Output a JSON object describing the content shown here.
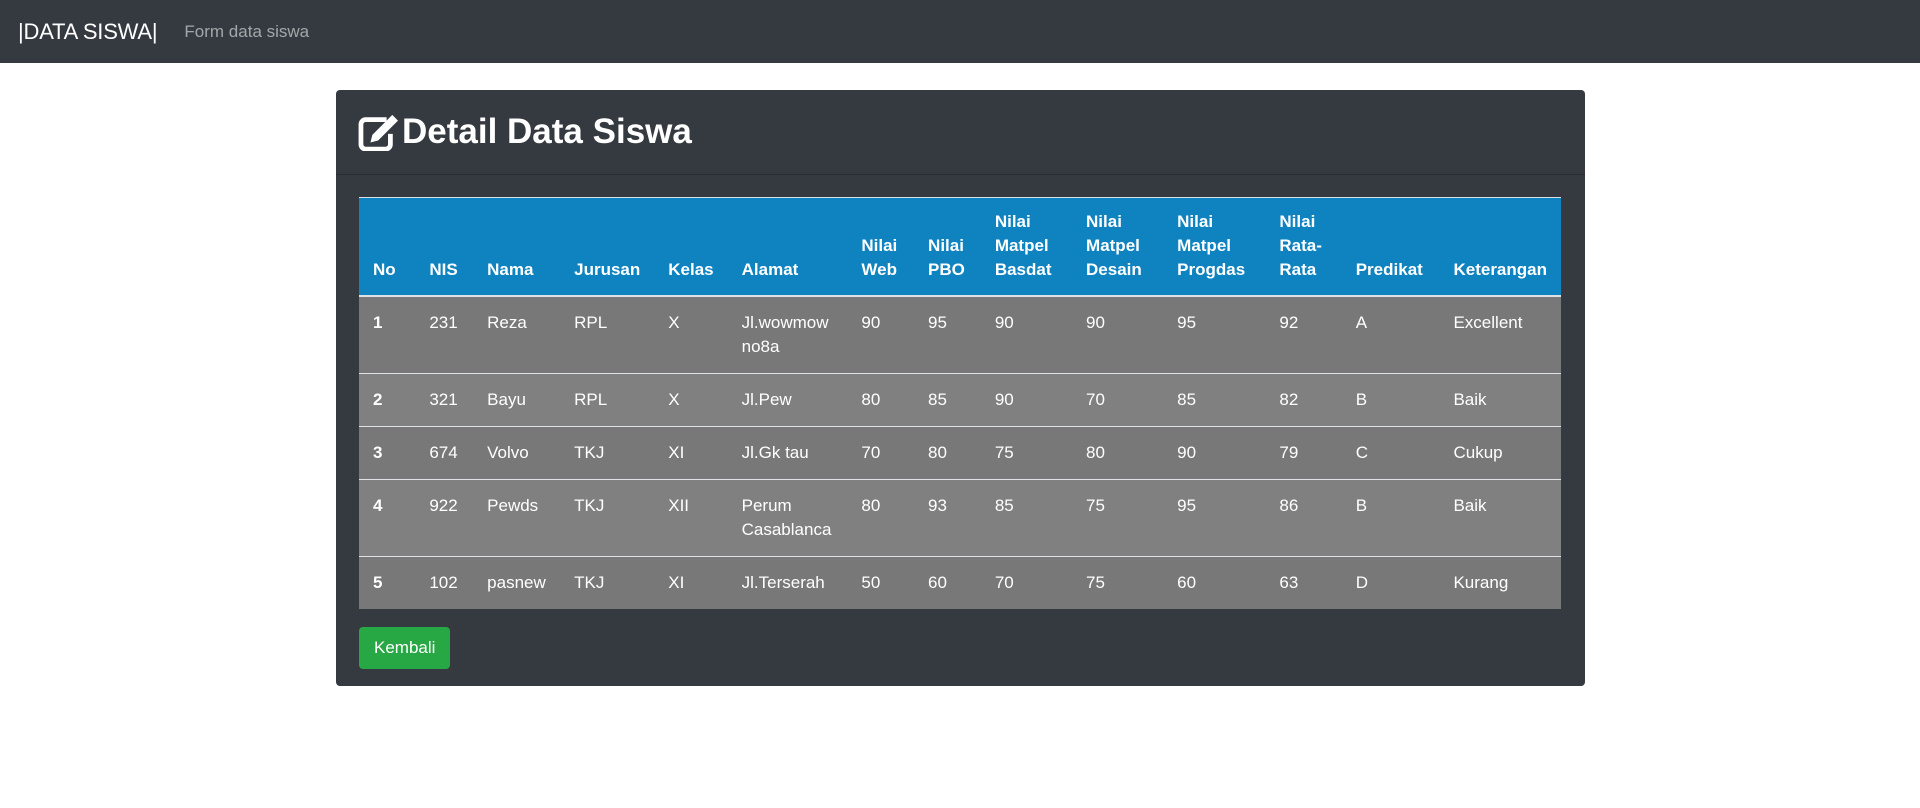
{
  "navbar": {
    "brand": "|DATA SISWA|",
    "link": "Form data siswa"
  },
  "card": {
    "title": "Detail Data Siswa",
    "icon": "edit-icon",
    "back_button": "Kembali"
  },
  "colors": {
    "navbar": "#343a40",
    "card": "#343a40",
    "table_header": "#0e83c0",
    "button": "#28a745"
  },
  "table": {
    "headers": [
      "No",
      "NIS",
      "Nama",
      "Jurusan",
      "Kelas",
      "Alamat",
      "Nilai Web",
      "Nilai PBO",
      "Nilai Matpel Basdat",
      "Nilai Matpel Desain",
      "Nilai Matpel Progdas",
      "Nilai Rata-Rata",
      "Predikat",
      "Keterangan"
    ],
    "rows": [
      [
        "1",
        "231",
        "Reza",
        "RPL",
        "X",
        "Jl.wowmowno8a",
        "90",
        "95",
        "90",
        "90",
        "95",
        "92",
        "A",
        "Excellent"
      ],
      [
        "2",
        "321",
        "Bayu",
        "RPL",
        "X",
        "Jl.Pew",
        "80",
        "85",
        "90",
        "70",
        "85",
        "82",
        "B",
        "Baik"
      ],
      [
        "3",
        "674",
        "Volvo",
        "TKJ",
        "XI",
        "Jl.Gk tau",
        "70",
        "80",
        "75",
        "80",
        "90",
        "79",
        "C",
        "Cukup"
      ],
      [
        "4",
        "922",
        "Pewds",
        "TKJ",
        "XII",
        "Perum Casablanca",
        "80",
        "93",
        "85",
        "75",
        "95",
        "86",
        "B",
        "Baik"
      ],
      [
        "5",
        "102",
        "pasnew",
        "TKJ",
        "XI",
        "Jl.Terserah",
        "50",
        "60",
        "70",
        "75",
        "60",
        "63",
        "D",
        "Kurang"
      ]
    ]
  }
}
